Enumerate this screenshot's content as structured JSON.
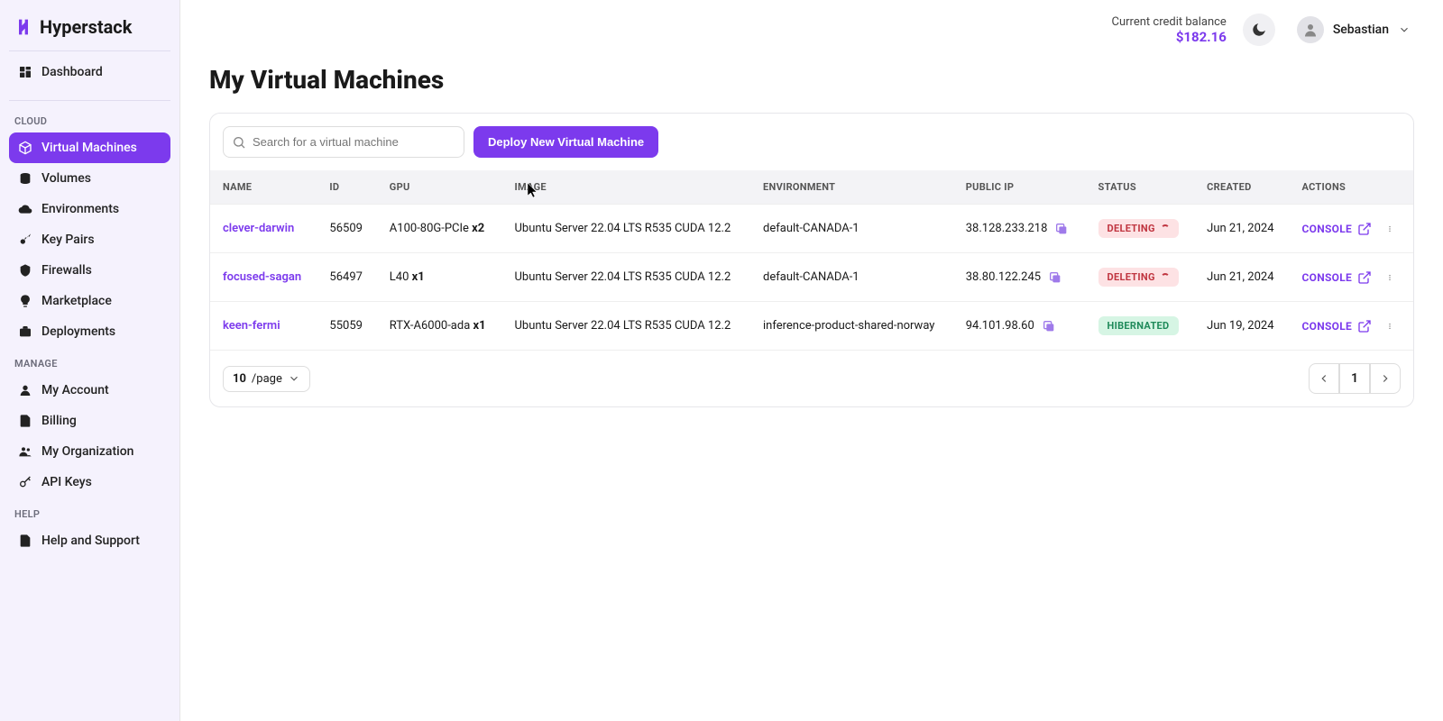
{
  "brand": "Hyperstack",
  "sidebar": {
    "dashboard": "Dashboard",
    "sections": {
      "cloud": "CLOUD",
      "manage": "MANAGE",
      "help": "HELP"
    },
    "cloud": {
      "vms": "Virtual Machines",
      "volumes": "Volumes",
      "envs": "Environments",
      "keypairs": "Key Pairs",
      "firewalls": "Firewalls",
      "marketplace": "Marketplace",
      "deployments": "Deployments"
    },
    "manage": {
      "account": "My Account",
      "billing": "Billing",
      "org": "My Organization",
      "apikeys": "API Keys"
    },
    "help": {
      "support": "Help and Support"
    }
  },
  "header": {
    "balance_label": "Current credit balance",
    "balance_value": "$182.16",
    "user_name": "Sebastian"
  },
  "page": {
    "title": "My Virtual Machines",
    "search_placeholder": "Search for a virtual machine",
    "deploy_label": "Deploy New Virtual Machine"
  },
  "table": {
    "columns": {
      "name": "NAME",
      "id": "ID",
      "gpu": "GPU",
      "image": "IMAGE",
      "environment": "ENVIRONMENT",
      "public_ip": "PUBLIC IP",
      "status": "STATUS",
      "created": "CREATED",
      "actions": "ACTIONS"
    },
    "rows": [
      {
        "name": "clever-darwin",
        "id": "56509",
        "gpu_model": "A100-80G-PCIe",
        "gpu_qty": "x2",
        "image": "Ubuntu Server 22.04 LTS R535 CUDA 12.2",
        "env": "default-CANADA-1",
        "ip": "38.128.233.218",
        "status": "DELETING",
        "status_kind": "deleting",
        "created": "Jun 21, 2024"
      },
      {
        "name": "focused-sagan",
        "id": "56497",
        "gpu_model": "L40",
        "gpu_qty": "x1",
        "image": "Ubuntu Server 22.04 LTS R535 CUDA 12.2",
        "env": "default-CANADA-1",
        "ip": "38.80.122.245",
        "status": "DELETING",
        "status_kind": "deleting",
        "created": "Jun 21, 2024"
      },
      {
        "name": "keen-fermi",
        "id": "55059",
        "gpu_model": "RTX-A6000-ada",
        "gpu_qty": "x1",
        "image": "Ubuntu Server 22.04 LTS R535 CUDA 12.2",
        "env": "inference-product-shared-norway",
        "ip": "94.101.98.60",
        "status": "HIBERNATED",
        "status_kind": "hibernated",
        "created": "Jun 19, 2024"
      }
    ],
    "console_label": "CONSOLE",
    "page_size_value": "10",
    "page_size_suffix": "/page",
    "current_page": "1"
  }
}
